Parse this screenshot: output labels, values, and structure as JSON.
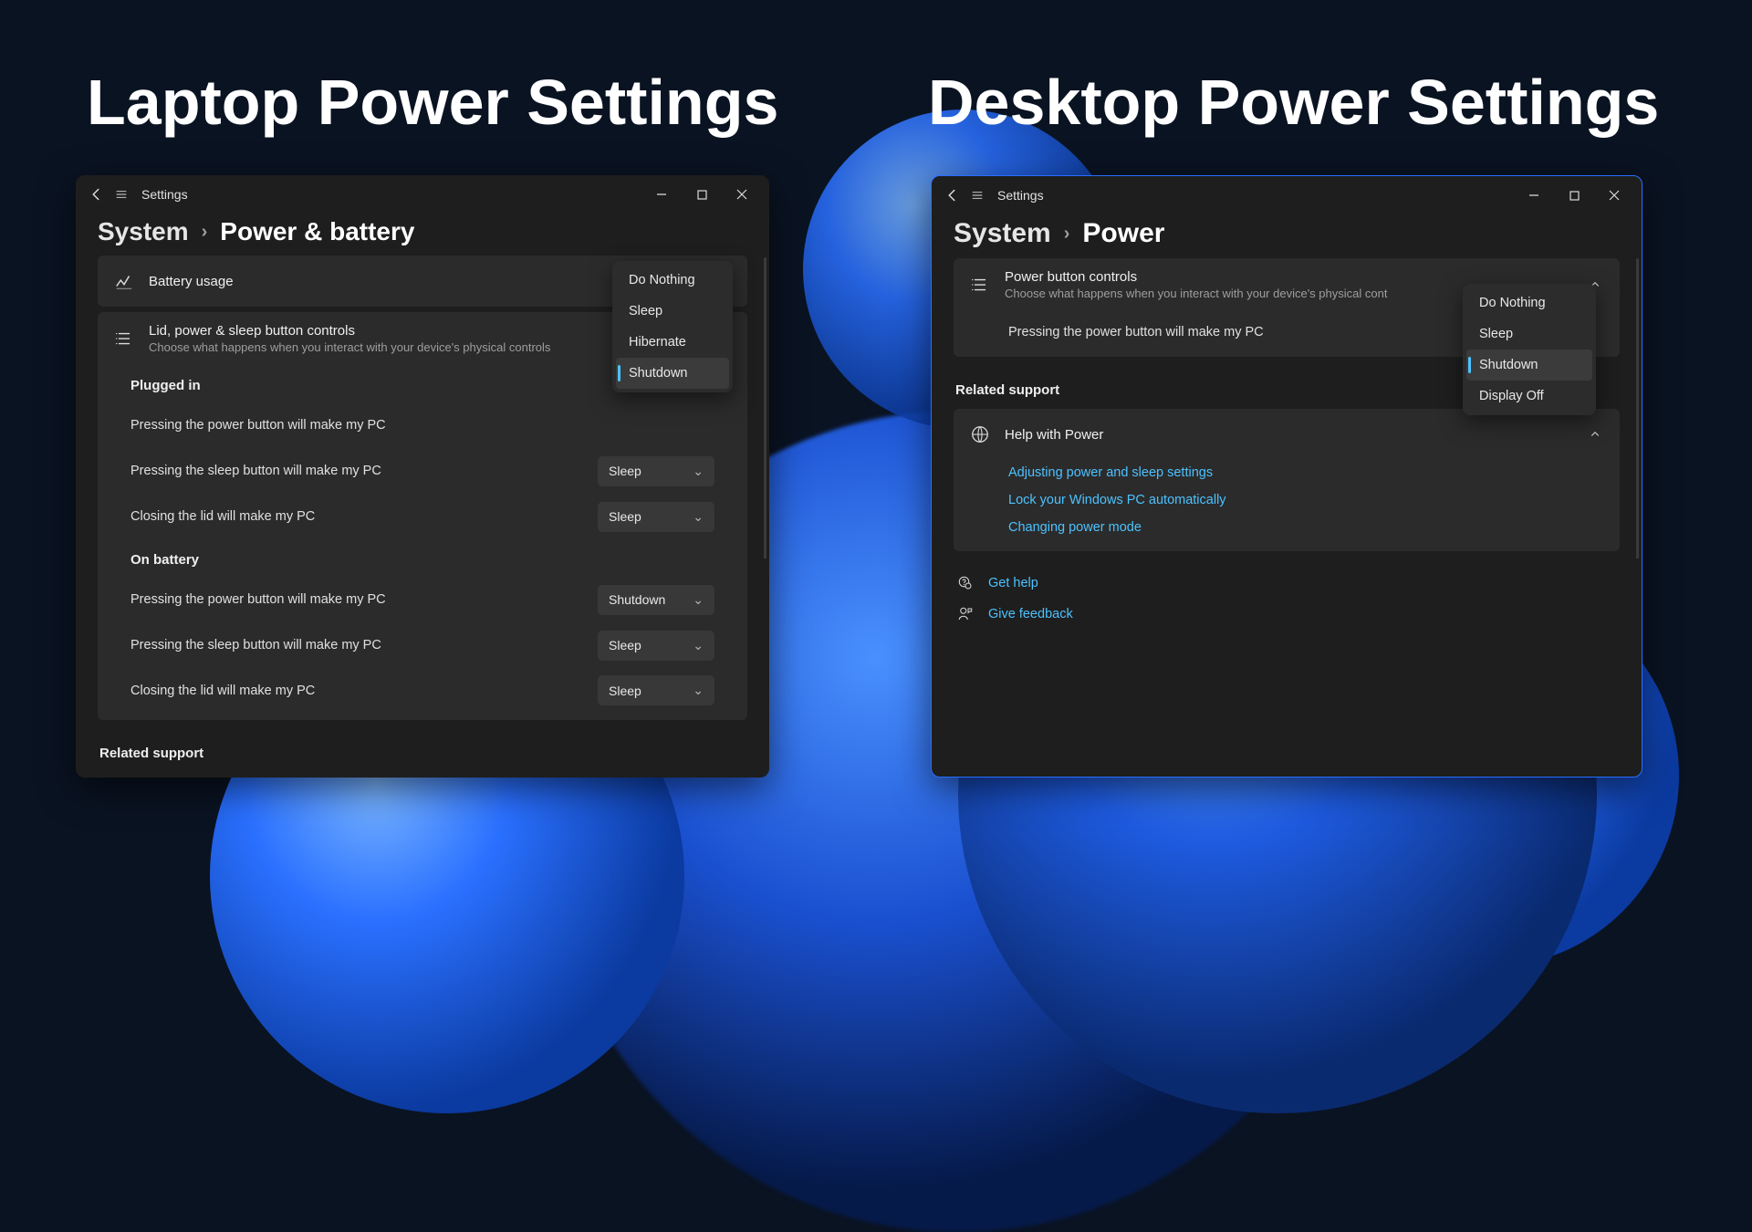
{
  "headings": {
    "left": "Laptop Power Settings",
    "right": "Desktop Power Settings"
  },
  "laptop": {
    "app_title": "Settings",
    "breadcrumb": {
      "parent": "System",
      "current": "Power & battery"
    },
    "battery_usage": "Battery usage",
    "controls": {
      "title": "Lid, power & sleep button controls",
      "subtitle": "Choose what happens when you interact with your device's physical controls"
    },
    "dropdown": {
      "options": [
        "Do Nothing",
        "Sleep",
        "Hibernate",
        "Shutdown"
      ],
      "selected": "Shutdown"
    },
    "sections": {
      "plugged": "Plugged in",
      "battery": "On battery"
    },
    "rows": {
      "power_btn": "Pressing the power button will make my PC",
      "sleep_btn": "Pressing the sleep button will make my PC",
      "lid": "Closing the lid will make my PC"
    },
    "values": {
      "plugged_sleep": "Sleep",
      "plugged_lid": "Sleep",
      "battery_power": "Shutdown",
      "battery_sleep": "Sleep",
      "battery_lid": "Sleep"
    },
    "related": "Related support"
  },
  "desktop": {
    "app_title": "Settings",
    "breadcrumb": {
      "parent": "System",
      "current": "Power"
    },
    "controls": {
      "title": "Power button controls",
      "subtitle": "Choose what happens when you interact with your device's physical cont"
    },
    "row": "Pressing the power button will make my PC",
    "dropdown": {
      "options": [
        "Do Nothing",
        "Sleep",
        "Shutdown",
        "Display Off"
      ],
      "selected": "Shutdown"
    },
    "related": "Related support",
    "help": {
      "title": "Help with Power",
      "links": [
        "Adjusting power and sleep settings",
        "Lock your Windows PC automatically",
        "Changing power mode"
      ]
    },
    "footer": {
      "get_help": "Get help",
      "feedback": "Give feedback"
    }
  }
}
